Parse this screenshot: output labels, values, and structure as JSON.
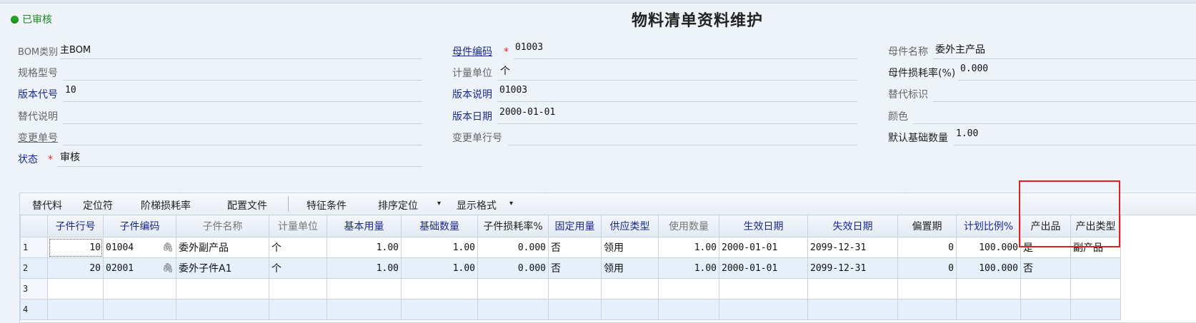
{
  "status": "已审核",
  "title": "物料清单资料维护",
  "colors": {
    "accent": "#1a2a8a",
    "status_green": "#22a322",
    "highlight": "#e02020",
    "row_alt": "#e6f0fb"
  },
  "icons": {
    "status": "status-dot-icon",
    "attachment": "paperclip-icon",
    "required": "asterisk-icon",
    "dropdown": "caret-down-icon"
  },
  "form": {
    "bom_type": {
      "label": "BOM类别",
      "value": "主BOM"
    },
    "spec": {
      "label": "规格型号",
      "value": ""
    },
    "version_code": {
      "label": "版本代号",
      "value": "10"
    },
    "sub_desc": {
      "label": "替代说明",
      "value": ""
    },
    "change_no": {
      "label": "变更单号",
      "value": ""
    },
    "state": {
      "label": "状态",
      "value": "审核"
    },
    "parent_code": {
      "label": "母件编码",
      "value": "01003"
    },
    "unit": {
      "label": "计量单位",
      "value": "个"
    },
    "version_desc": {
      "label": "版本说明",
      "value": "01003"
    },
    "version_date": {
      "label": "版本日期",
      "value": "2000-01-01"
    },
    "change_line": {
      "label": "变更单行号",
      "value": ""
    },
    "parent_name": {
      "label": "母件名称",
      "value": "委外主产品"
    },
    "parent_loss": {
      "label": "母件损耗率(%)",
      "value": "0.000"
    },
    "sub_flag": {
      "label": "替代标识",
      "value": ""
    },
    "color": {
      "label": "颜色",
      "value": ""
    },
    "default_qty": {
      "label": "默认基础数量",
      "value": "1.00"
    },
    "required_mark": "*"
  },
  "toolbar": {
    "substitute": "替代料",
    "locator": "定位符",
    "step_loss": "阶梯损耗率",
    "config_file": "配置文件",
    "feature": "特征条件",
    "sort_locate": "排序定位",
    "display_format": "显示格式",
    "caret": "▾"
  },
  "grid": {
    "columns": [
      "子件行号",
      "子件编码",
      "子件名称",
      "计量单位",
      "基本用量",
      "基础数量",
      "子件损耗率%",
      "固定用量",
      "供应类型",
      "使用数量",
      "生效日期",
      "失效日期",
      "偏置期",
      "计划比例%",
      "产出品",
      "产出类型"
    ],
    "rows": [
      {
        "n": "1",
        "line": "10",
        "code": "01004",
        "name": "委外副产品",
        "unit": "个",
        "base": "1.00",
        "basic": "1.00",
        "loss": "0.000",
        "fixed": "否",
        "supply": "领用",
        "use": "1.00",
        "eff": "2000-01-01",
        "exp": "2099-12-31",
        "offset": "0",
        "ratio": "100.000",
        "output": "是",
        "output_type": "副产品"
      },
      {
        "n": "2",
        "line": "20",
        "code": "02001",
        "name": "委外子件A1",
        "unit": "个",
        "base": "1.00",
        "basic": "1.00",
        "loss": "0.000",
        "fixed": "否",
        "supply": "领用",
        "use": "1.00",
        "eff": "2000-01-01",
        "exp": "2099-12-31",
        "offset": "0",
        "ratio": "100.000",
        "output": "否",
        "output_type": ""
      },
      {
        "n": "3"
      },
      {
        "n": "4"
      }
    ]
  }
}
